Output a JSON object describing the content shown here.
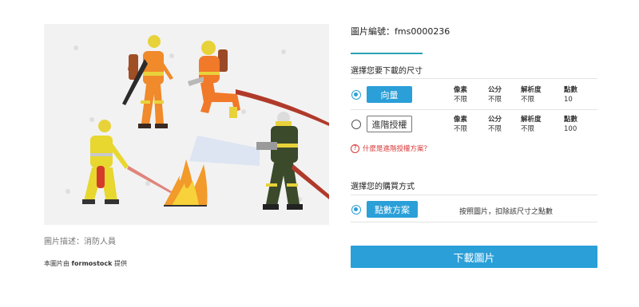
{
  "image": {
    "alt": "消防人員",
    "description_label": "圖片描述：消防人員",
    "credit_prefix": "本圖片由",
    "credit_brand": "formostock",
    "credit_suffix": "提供"
  },
  "image_id_label": "圖片編號：fms0000236",
  "size_section": {
    "title": "選擇您要下載的尺寸",
    "options": [
      {
        "label": "向量",
        "selected": true,
        "specs": [
          {
            "header": "像素",
            "value": "不限"
          },
          {
            "header": "公分",
            "value": "不限"
          },
          {
            "header": "解析度",
            "value": "不限"
          },
          {
            "header": "點數",
            "value": "10"
          }
        ]
      },
      {
        "label": "進階授權",
        "selected": false,
        "specs": [
          {
            "header": "像素",
            "value": "不限"
          },
          {
            "header": "公分",
            "value": "不限"
          },
          {
            "header": "解析度",
            "value": "不限"
          },
          {
            "header": "點數",
            "value": "100"
          }
        ]
      }
    ],
    "help_link": "什麼是進階授權方案？"
  },
  "purchase_section": {
    "title": "選擇您的購買方式",
    "option_label": "點數方案",
    "option_selected": true,
    "note": "按照圖片，扣除該尺寸之點數"
  },
  "download_button": "下載圖片",
  "colors": {
    "accent": "#2a9fd8",
    "teal": "#2aa3b8",
    "help": "#d93838"
  }
}
